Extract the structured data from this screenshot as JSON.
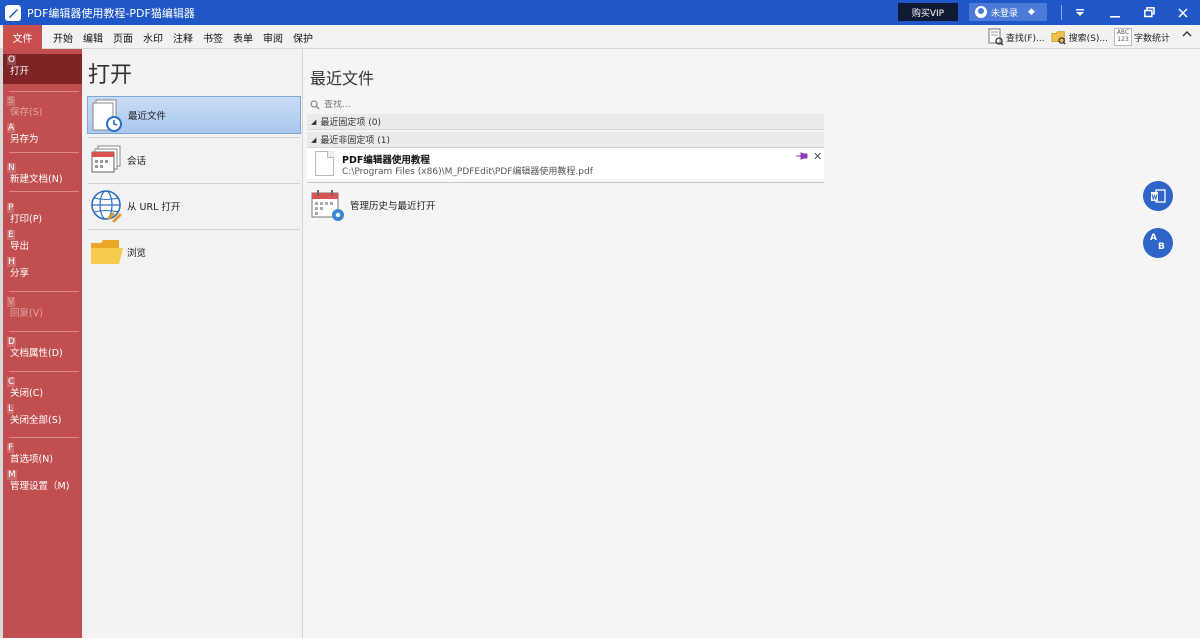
{
  "window": {
    "title": "PDF编辑器使用教程-PDF猫编辑器",
    "vip_label": "购买VIP",
    "login_label": "未登录"
  },
  "ribbon": {
    "file_tab": "文件",
    "tabs": [
      "开始",
      "编辑",
      "页面",
      "水印",
      "注释",
      "书签",
      "表单",
      "审阅",
      "保护"
    ],
    "find_label": "查找(F)...",
    "search_label": "搜索(S)...",
    "wordcount_label": "字数统计",
    "abc_text": "ABC",
    "num_text": "123"
  },
  "nav": {
    "items": [
      {
        "key": "O",
        "label": "打开"
      },
      {
        "key": "S",
        "label": "保存(S)"
      },
      {
        "key": "A",
        "label": "另存为"
      },
      {
        "key": "N",
        "label": "新建文档(N)"
      },
      {
        "key": "P",
        "label": "打印(P)"
      },
      {
        "key": "E",
        "label": "导出"
      },
      {
        "key": "H",
        "label": "分享"
      },
      {
        "key": "V",
        "label": "回复(V)"
      },
      {
        "key": "D",
        "label": "文档属性(D)"
      },
      {
        "key": "C",
        "label": "关闭(C)"
      },
      {
        "key": "L",
        "label": "关闭全部(S)"
      },
      {
        "key": "F",
        "label": "首选项(N)"
      },
      {
        "key": "M",
        "label": "管理设置（M)"
      }
    ]
  },
  "open_panel": {
    "title": "打开",
    "options": [
      {
        "label": "最近文件"
      },
      {
        "label": "会话"
      },
      {
        "label": "从 URL 打开"
      },
      {
        "label": "浏览"
      }
    ]
  },
  "recent": {
    "title": "最近文件",
    "search_placeholder": "查找...",
    "pinned_header": "最近固定项 (0)",
    "unpinned_header": "最近非固定项 (1)",
    "file": {
      "name": "PDF编辑器使用教程",
      "path": "C:\\Program Files (x86)\\M_PDFEdit\\PDF编辑器使用教程.pdf"
    },
    "manage_label": "管理历史与最近打开"
  },
  "fab": {
    "ab_text": "A",
    "ab_text2": "B"
  },
  "colors": {
    "titlebar": "#1f56c8",
    "nav": "#c24f4f",
    "nav_active": "#7e2424",
    "selected": "#a9c8ee"
  }
}
